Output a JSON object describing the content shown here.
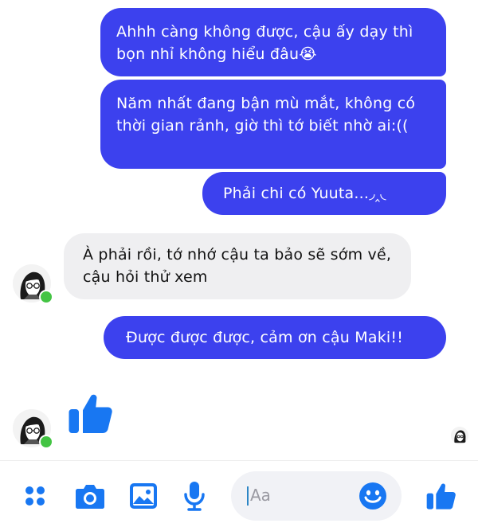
{
  "colors": {
    "outgoing_bubble": "#3c41ee",
    "incoming_bubble": "#efeff1",
    "accent": "#1877f2",
    "online": "#43c443"
  },
  "messages": [
    {
      "direction": "out",
      "text": "Ahhh càng không được, cậu ấy dạy thì bọn nhỉ không hiểu đâu😭"
    },
    {
      "direction": "out",
      "text": "Năm nhất đang bận mù mắt, không có thời gian rảnh, giờ thì tớ biết nhờ ai:(("
    },
    {
      "direction": "out",
      "text": "Phải chi có Yuuta...◞‸◟"
    },
    {
      "direction": "in",
      "text": "À phải rồi, tớ nhớ cậu ta bảo sẽ sớm về, cậu hỏi thử xem"
    },
    {
      "direction": "out",
      "text": "Được được được, cảm ơn cậu Maki!!"
    }
  ],
  "thread": {
    "last_sticker": "like-sticker",
    "contact_online": true
  },
  "composer": {
    "placeholder": "Aa",
    "tools": [
      "menu-icon",
      "camera-icon",
      "gallery-icon",
      "microphone-icon"
    ],
    "emoji_icon": "smiley-icon",
    "send_icon": "thumbs-up-icon"
  }
}
